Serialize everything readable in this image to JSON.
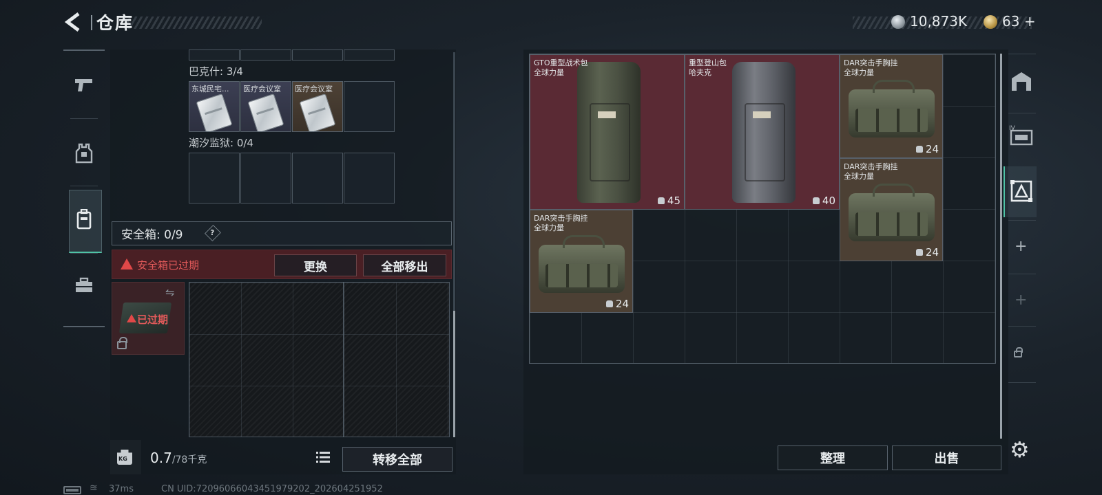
{
  "header": {
    "title": "仓库",
    "currency_a_value": "10,873K",
    "currency_b_value": "63",
    "currency_b_plus": "+"
  },
  "left_tabs": [
    {
      "icon": "pistol-icon"
    },
    {
      "icon": "armor-vest-icon"
    },
    {
      "icon": "backpack-icon",
      "active": true
    },
    {
      "icon": "toolbox-icon"
    }
  ],
  "keys": {
    "bakeshi": {
      "label": "巴克什: 3/4",
      "cards": [
        {
          "name": "东城民宅...",
          "tone": "slate"
        },
        {
          "name": "医疗会议室",
          "tone": "slate"
        },
        {
          "name": "医疗会议室",
          "tone": "amber"
        }
      ]
    },
    "chaoxi": {
      "label": "潮汐监狱: 0/4"
    }
  },
  "safe_box": {
    "label": "安全箱:",
    "count": "0/9",
    "help": "?",
    "expired_warning": "安全箱已过期",
    "replace_label": "更换",
    "remove_all_label": "全部移出",
    "case_status": "已过期"
  },
  "footer_left": {
    "weight_icon_text": "KG",
    "weight_current": "0.7",
    "weight_max": "/78千克",
    "transfer_all_label": "转移全部"
  },
  "stash_items": [
    {
      "line1": "GTO重型战术包",
      "line2": "全球力量",
      "capacity": "45",
      "bg": "red",
      "kind": "backpack-green"
    },
    {
      "line1": "重型登山包",
      "line2": "哈夫克",
      "capacity": "40",
      "bg": "red",
      "kind": "backpack-grey"
    },
    {
      "line1": "DAR突击手胸挂",
      "line2": "全球力量",
      "capacity": "24",
      "bg": "tan",
      "kind": "chest-rig"
    },
    {
      "line1": "DAR突击手胸挂",
      "line2": "全球力量",
      "capacity": "24",
      "bg": "tan",
      "kind": "chest-rig"
    },
    {
      "line1": "DAR突击手胸挂",
      "line2": "全球力量",
      "capacity": "24",
      "bg": "tan",
      "kind": "chest-rig"
    }
  ],
  "stash_actions": {
    "sort_label": "整理",
    "sell_label": "出售"
  },
  "right_tabs": [
    {
      "icon": "storage-arch-icon"
    },
    {
      "icon": "item-tag-icon",
      "text": "IV"
    },
    {
      "icon": "equipment-frame-icon",
      "active": true
    },
    {
      "icon": "add-icon",
      "text": "+"
    },
    {
      "icon": "add-disabled-icon",
      "text": "+"
    },
    {
      "icon": "lock-icon"
    }
  ],
  "status_bar": {
    "ping": "37ms",
    "uid": "CN UID:72096066043451979202_202604251952"
  },
  "colors": {
    "accent": "#4fc3a6",
    "warning": "#e35a5a",
    "expired_bg": "#4a1f24",
    "item_red": "#5a2a34",
    "item_tan": "#4c4034"
  }
}
